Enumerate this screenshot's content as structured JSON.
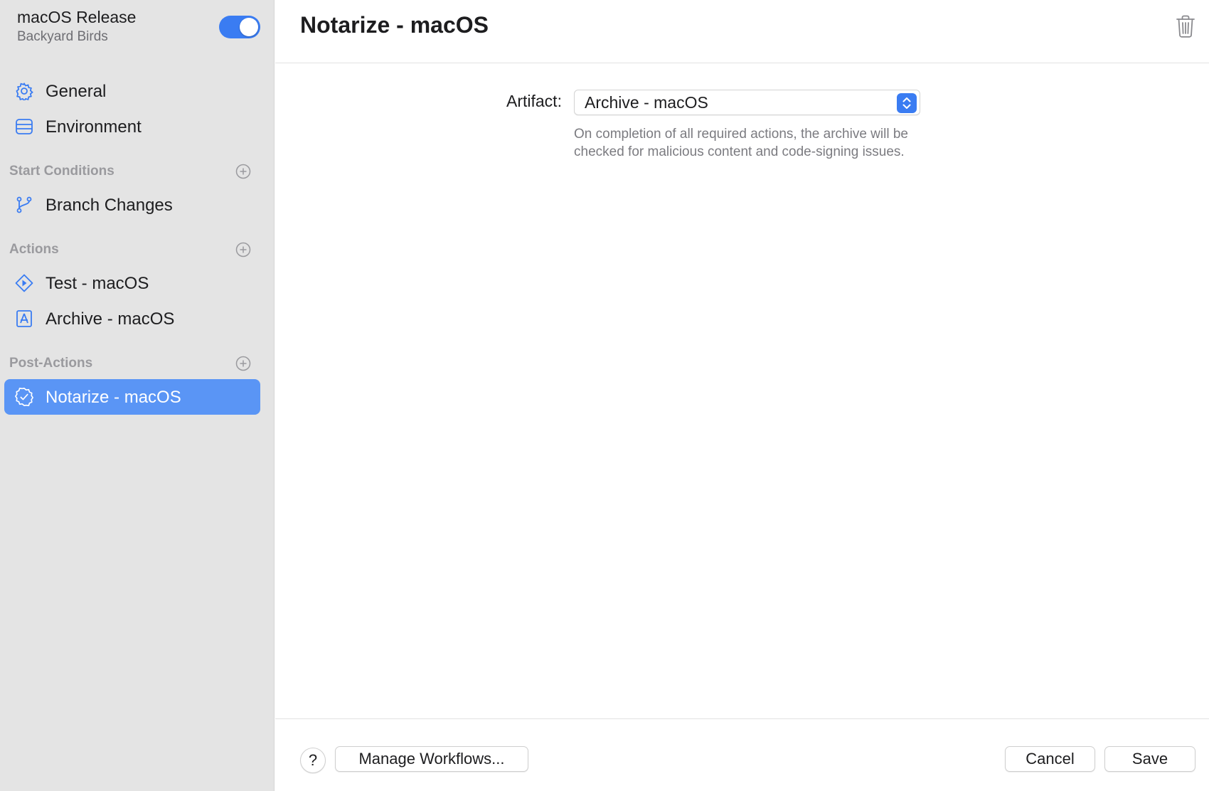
{
  "sidebar": {
    "workflow_name": "macOS Release",
    "product_name": "Backyard Birds",
    "enabled": true,
    "items": {
      "general": {
        "label": "General",
        "icon": "gear-icon"
      },
      "environment": {
        "label": "Environment",
        "icon": "server-icon"
      },
      "branch_changes": {
        "label": "Branch Changes",
        "icon": "branch-icon"
      },
      "test": {
        "label": "Test - macOS",
        "icon": "play-diamond-icon"
      },
      "archive": {
        "label": "Archive - macOS",
        "icon": "app-store-document-icon"
      },
      "notarize": {
        "label": "Notarize - macOS",
        "icon": "checkmark-seal-icon"
      }
    },
    "sections": {
      "start_conditions": "Start Conditions",
      "actions": "Actions",
      "post_actions": "Post-Actions"
    },
    "selected_item": "notarize"
  },
  "main": {
    "title": "Notarize - macOS",
    "artifact_label": "Artifact:",
    "artifact_value": "Archive - macOS",
    "help_text": "On completion of all required actions, the archive will be checked for malicious content and code-signing issues."
  },
  "footer": {
    "help_label": "?",
    "manage_label": "Manage Workflows...",
    "cancel_label": "Cancel",
    "save_label": "Save"
  },
  "colors": {
    "accent": "#3a7cf2",
    "selection": "#5a95f5",
    "sidebar_bg": "#e4e4e4"
  }
}
